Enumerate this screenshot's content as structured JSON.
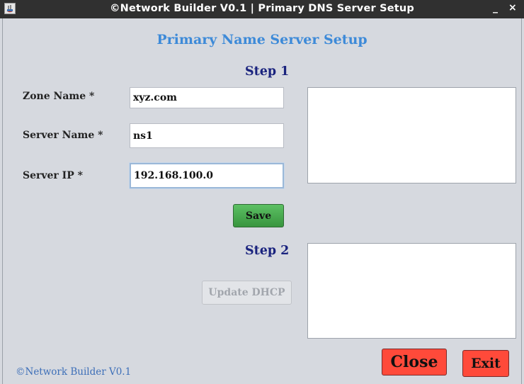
{
  "window": {
    "title": "©Network Builder V0.1 | Primary DNS Server Setup",
    "minimize": "_",
    "close": "×"
  },
  "heading": "Primary Name Server Setup",
  "step1": {
    "label": "Step 1",
    "zone_name": {
      "label": "Zone Name *",
      "value": "xyz.com"
    },
    "server_name": {
      "label": "Server Name *",
      "value": "ns1"
    },
    "server_ip": {
      "label": "Server IP *",
      "value": "192.168.100.0"
    },
    "save_button": "Save"
  },
  "step2": {
    "label": "Step 2",
    "update_dhcp_button": "Update DHCP"
  },
  "buttons": {
    "close": "Close",
    "exit": "Exit"
  },
  "footer": "©Network Builder V0.1",
  "colors": {
    "heading": "#3d8ad8",
    "step": "#1a237e",
    "save": "#4caf50",
    "danger": "#ff4a3a",
    "footer": "#3d6fb8"
  }
}
